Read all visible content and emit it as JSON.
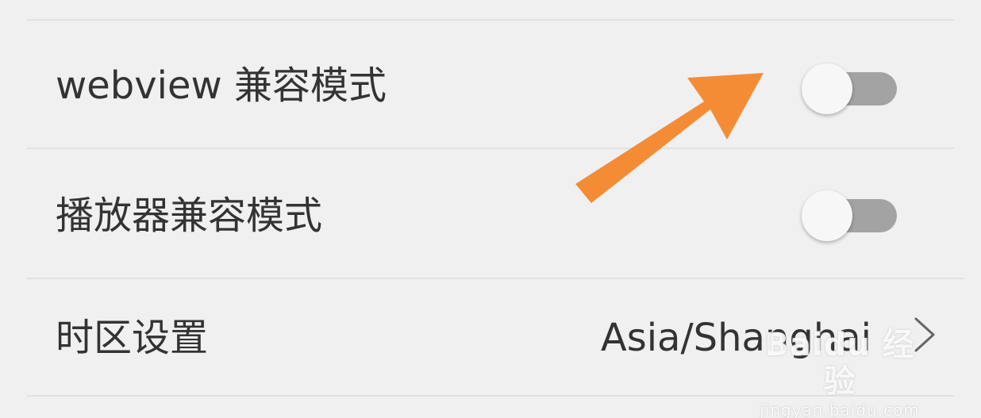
{
  "settings": {
    "rows": [
      {
        "label": "webview 兼容模式",
        "control": "toggle",
        "on": false
      },
      {
        "label": "播放器兼容模式",
        "control": "toggle",
        "on": false
      },
      {
        "label": "时区设置",
        "value": "Asia/Shanghai",
        "control": "disclosure"
      }
    ]
  },
  "icons": {
    "annotation": "arrow-icon",
    "disclosure": "chevron-right-icon"
  },
  "colors": {
    "background": "#f0f0f0",
    "text": "#333333",
    "toggle_track_off": "#a3a3a3",
    "toggle_knob": "#f7f7f7",
    "annotation_arrow": "#f48c36",
    "divider": "#e2e2e2"
  },
  "watermark": {
    "brand": "Baidu 经验",
    "url": "jingyan.baidu.com"
  }
}
